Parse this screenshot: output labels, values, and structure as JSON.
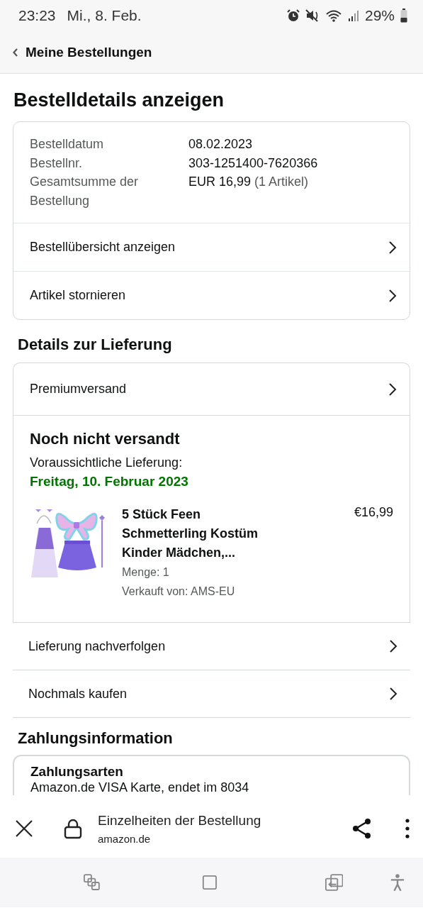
{
  "status_bar": {
    "time": "23:23",
    "date": "Mi., 8. Feb.",
    "battery": "29%"
  },
  "header": {
    "back_label": "Meine Bestellungen"
  },
  "page_title": "Bestelldetails anzeigen",
  "order_summary": {
    "fields": [
      {
        "label": "Bestelldatum",
        "value": "08.02.2023"
      },
      {
        "label": "Bestellnr.",
        "value": "303-1251400-7620366"
      },
      {
        "label": "Gesamtsumme der Bestellung",
        "value": "EUR 16,99",
        "note": "(1 Artikel)"
      }
    ],
    "links": [
      "Bestellübersicht anzeigen",
      "Artikel stornieren"
    ]
  },
  "delivery": {
    "heading": "Details zur Lieferung",
    "shipping_method": "Premiumversand",
    "status": "Noch nicht versandt",
    "eta_label": "Voraussichtliche Lieferung:",
    "eta_date": "Freitag, 10. Februar 2023",
    "item": {
      "title": "5 Stück Feen Schmetterling Kostüm Kinder Mädchen,...",
      "price": "€16,99",
      "quantity": "Menge: 1",
      "seller": "Verkauft von: AMS-EU"
    },
    "actions": [
      "Lieferung nachverfolgen",
      "Nochmals kaufen"
    ]
  },
  "payment": {
    "heading": "Zahlungsinformation",
    "methods_label": "Zahlungsarten",
    "method": "Amazon.de VISA Karte, endet im 8034"
  },
  "browser_bar": {
    "title": "Einzelheiten der Bestellung",
    "domain": "amazon.de"
  }
}
